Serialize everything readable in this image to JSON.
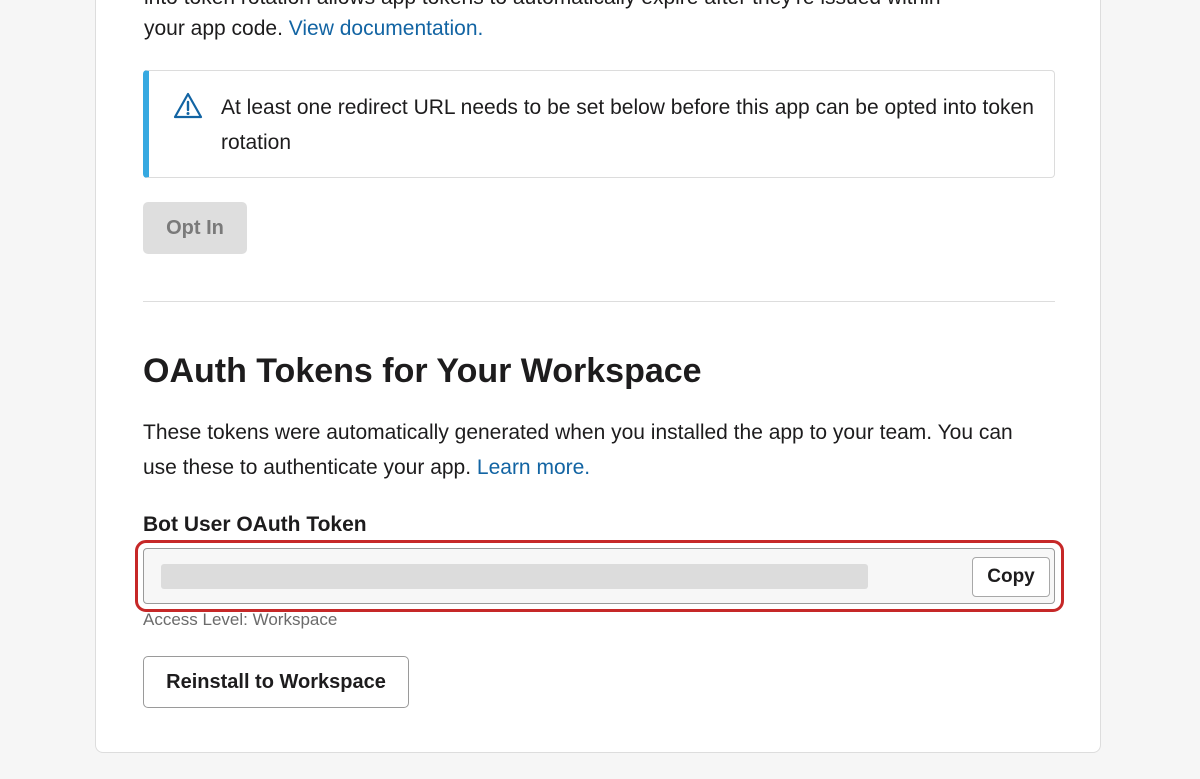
{
  "token_rotation": {
    "cut_text": "into token rotation allows app tokens to automatically expire after they're issued within",
    "intro_text": "your app code. ",
    "doc_link": "View documentation.",
    "callout": {
      "icon": "warning-triangle-icon",
      "text": "At least one redirect URL needs to be set below before this app can be opted into token rotation"
    },
    "opt_in_label": "Opt In"
  },
  "oauth_section": {
    "title": "OAuth Tokens for Your Workspace",
    "description": "These tokens were automatically generated when you installed the app to your team. You can use these to authenticate your app. ",
    "learn_more_link": "Learn more.",
    "bot_token": {
      "label": "Bot User OAuth Token",
      "copy_label": "Copy",
      "access_level": "Access Level: Workspace"
    },
    "reinstall_label": "Reinstall to Workspace"
  },
  "colors": {
    "link": "#1264a3",
    "callout_accent": "#36a9e1",
    "highlight": "#c62828"
  }
}
